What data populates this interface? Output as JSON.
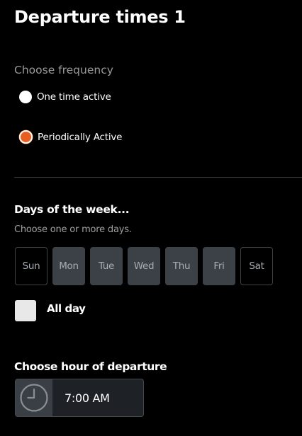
{
  "page": {
    "title": "Departure times 1"
  },
  "frequency": {
    "label": "Choose frequency",
    "options": [
      {
        "label": "One time active",
        "selected": false
      },
      {
        "label": "Periodically Active",
        "selected": true
      }
    ],
    "accent_color": "#e85d20"
  },
  "days_section": {
    "heading": "Days of the week...",
    "subtitle": "Choose one or more days.",
    "days": [
      {
        "label": "Sun",
        "selected": false
      },
      {
        "label": "Mon",
        "selected": true
      },
      {
        "label": "Tue",
        "selected": true
      },
      {
        "label": "Wed",
        "selected": true
      },
      {
        "label": "Thu",
        "selected": true
      },
      {
        "label": "Fri",
        "selected": true
      },
      {
        "label": "Sat",
        "selected": false
      }
    ],
    "all_day": {
      "label": "All day",
      "checked": false
    }
  },
  "departure": {
    "heading": "Choose hour of departure",
    "time_value": "7:00 AM",
    "icon": "clock-icon"
  }
}
